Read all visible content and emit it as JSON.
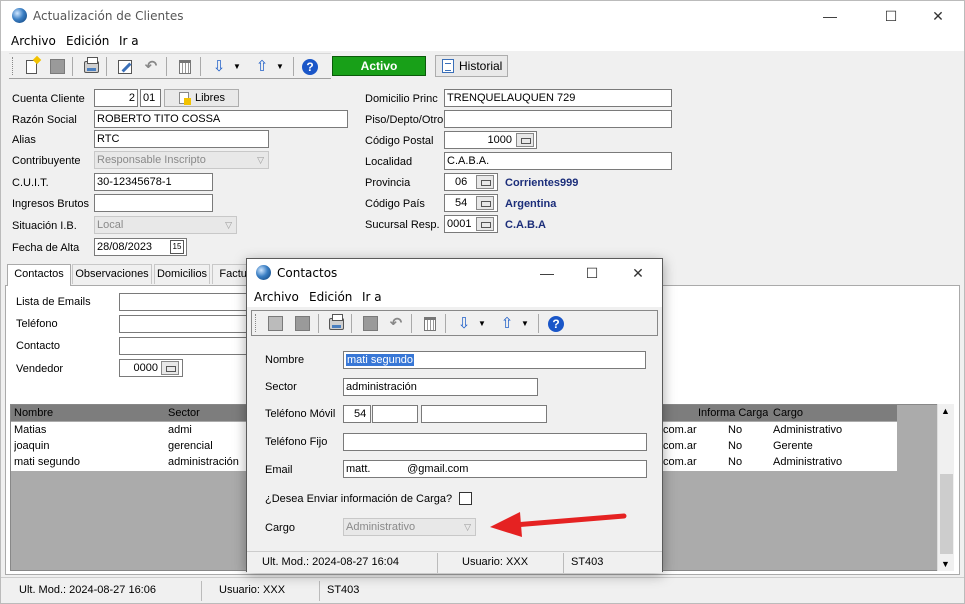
{
  "window": {
    "title": "Actualización de Clientes",
    "controls": {
      "minimize": "—",
      "maximize": "☐",
      "close": "✕"
    }
  },
  "menu": [
    "Archivo",
    "Edición",
    "Ir a"
  ],
  "toolbar": {
    "status_button": "Activo",
    "historial_label": "Historial"
  },
  "form": {
    "cuenta_cliente_label": "Cuenta Cliente",
    "cuenta_cliente_value": "2",
    "cuenta_cliente_sub": "01",
    "libres_label": "Libres",
    "razon_social_label": "Razón Social",
    "razon_social_value": "ROBERTO TITO COSSA",
    "alias_label": "Alias",
    "alias_value": "RTC",
    "contribuyente_label": "Contribuyente",
    "contribuyente_value": "Responsable Inscripto",
    "cuit_label": "C.U.I.T.",
    "cuit_value": "30-12345678-1",
    "ingresos_brutos_label": "Ingresos Brutos",
    "ingresos_brutos_value": "",
    "situacion_ib_label": "Situación I.B.",
    "situacion_ib_value": "Local",
    "fecha_alta_label": "Fecha de Alta",
    "fecha_alta_value": "28/08/2023",
    "calendar_glyph": "15",
    "domicilio_label": "Domicilio Princ",
    "domicilio_value": "TRENQUELAUQUEN 729",
    "piso_label": "Piso/Depto/Otro",
    "piso_value": "",
    "codigo_postal_label": "Código Postal",
    "codigo_postal_value": "1000",
    "localidad_label": "Localidad",
    "localidad_value": "C.A.B.A.",
    "provincia_label": "Provincia",
    "provincia_code": "06",
    "provincia_name": "Corrientes999",
    "codigo_pais_label": "Código País",
    "codigo_pais_code": "54",
    "codigo_pais_name": "Argentina",
    "sucursal_label": "Sucursal Resp.",
    "sucursal_code": "0001",
    "sucursal_name": "C.A.B.A"
  },
  "tabs": [
    "Contactos",
    "Observaciones",
    "Domicilios",
    "Factur"
  ],
  "contactos_tab": {
    "lista_emails_label": "Lista de Emails",
    "telefono_label": "Teléfono",
    "contacto_label": "Contacto",
    "vendedor_label": "Vendedor",
    "vendedor_value": "0000"
  },
  "grid": {
    "headers_left": [
      "Nombre",
      "Sector"
    ],
    "headers_right": [
      "Informa Carga",
      "Cargo"
    ],
    "rows": [
      {
        "nombre": "Matias",
        "sector": "admi",
        "email_tail": "com.ar",
        "informa": "No",
        "cargo": "Administrativo"
      },
      {
        "nombre": "joaquin",
        "sector": "gerencial",
        "email_tail": "com.ar",
        "informa": "No",
        "cargo": "Gerente"
      },
      {
        "nombre": "mati segundo",
        "sector": "administración",
        "email_tail": "com.ar",
        "informa": "No",
        "cargo": "Administrativo"
      }
    ]
  },
  "statusbar": {
    "ult_mod": "Ult. Mod.: 2024-08-27 16:06",
    "usuario": "Usuario: XXX",
    "terminal": "ST403"
  },
  "dialog": {
    "title": "Contactos",
    "controls": {
      "minimize": "—",
      "maximize": "☐",
      "close": "✕"
    },
    "menu": [
      "Archivo",
      "Edición",
      "Ir a"
    ],
    "nombre_label": "Nombre",
    "nombre_value": "mati segundo",
    "sector_label": "Sector",
    "sector_value": "administración",
    "telefono_movil_label": "Teléfono Móvil",
    "telefono_movil_code": "54",
    "telefono_movil_area": "",
    "telefono_movil_number": "",
    "telefono_fijo_label": "Teléfono Fijo",
    "telefono_fijo_value": "",
    "email_label": "Email",
    "email_value": "matt.            @gmail.com",
    "enviar_carga_label": "¿Desea Enviar información de Carga?",
    "cargo_label": "Cargo",
    "cargo_value": "Administrativo",
    "status": {
      "ult_mod": "Ult. Mod.: 2024-08-27 16:04",
      "usuario": "Usuario: XXX",
      "terminal": "ST403"
    }
  },
  "colors": {
    "activo_green": "#18a018",
    "annotation_arrow": "#e52222",
    "lookup_text_blue": "#1c2e7a",
    "selection_blue": "#3877d6"
  }
}
